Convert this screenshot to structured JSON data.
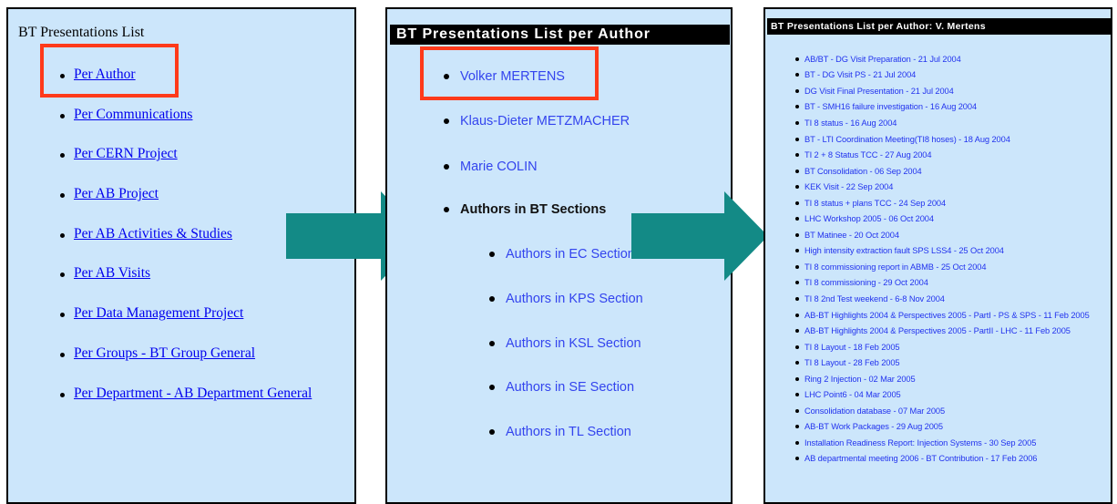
{
  "panel1": {
    "title": "BT Presentations List",
    "items": [
      {
        "label": "Per Author"
      },
      {
        "label": "Per Communications"
      },
      {
        "label": "Per CERN Project"
      },
      {
        "label": "Per AB Project"
      },
      {
        "label": "Per AB Activities & Studies"
      },
      {
        "label": "Per AB Visits"
      },
      {
        "label": "Per Data Management Project"
      },
      {
        "label": "Per Groups - BT Group General"
      },
      {
        "label": "Per Department - AB Department General"
      }
    ]
  },
  "panel2": {
    "title": "BT Presentations List per Author",
    "authors": [
      {
        "label": "Volker MERTENS"
      },
      {
        "label": "Klaus-Dieter METZMACHER"
      },
      {
        "label": "Marie COLIN"
      }
    ],
    "sections_heading": "Authors in BT Sections",
    "sections": [
      {
        "label": "Authors in EC Section"
      },
      {
        "label": "Authors in KPS Section"
      },
      {
        "label": "Authors in KSL Section"
      },
      {
        "label": "Authors in SE Section"
      },
      {
        "label": "Authors in TL Section"
      }
    ]
  },
  "panel3": {
    "title": "BT Presentations List per Author: V. Mertens",
    "items": [
      "AB/BT - DG Visit Preparation - 21 Jul 2004",
      "BT - DG Visit PS - 21 Jul 2004",
      "DG Visit Final Presentation - 21 Jul 2004",
      "BT - SMH16 failure investigation - 16 Aug 2004",
      "TI 8 status - 16 Aug 2004",
      "BT - LTI Coordination Meeting(TI8 hoses) - 18 Aug 2004",
      "TI 2 + 8 Status TCC - 27 Aug 2004",
      "BT Consolidation - 06 Sep 2004",
      "KEK Visit - 22 Sep 2004",
      "TI 8 status + plans TCC - 24 Sep 2004",
      "LHC Workshop 2005 - 06 Oct 2004",
      "BT Matinee - 20 Oct 2004",
      "High intensity extraction fault SPS LSS4 - 25 Oct 2004",
      "TI 8 commissioning report in ABMB - 25 Oct 2004",
      "TI 8 commissioning - 29 Oct 2004",
      "TI 8 2nd Test weekend - 6-8 Nov 2004",
      "AB-BT Highlights 2004 & Perspectives 2005 - PartI - PS & SPS - 11 Feb 2005",
      "AB-BT Highlights 2004 & Perspectives 2005 - PartII - LHC - 11 Feb 2005",
      "TI 8 Layout - 18 Feb 2005",
      "TI 8 Layout - 28 Feb 2005",
      "Ring 2 Injection - 02 Mar 2005",
      "LHC Point6 - 04 Mar 2005",
      "Consolidation database - 07 Mar 2005",
      "AB-BT Work Packages - 29 Aug 2005",
      "Installation Readiness Report: Injection Systems - 30 Sep 2005",
      "AB departmental meeting 2006 - BT Contribution - 17 Feb 2006"
    ]
  },
  "colors": {
    "panel_bg": "#cce6fb",
    "link": "#0000ee",
    "highlight": "#ff3a1a",
    "arrow": "#138a86"
  },
  "icons": [
    "arrow-right-icon",
    "bullet-icon"
  ]
}
